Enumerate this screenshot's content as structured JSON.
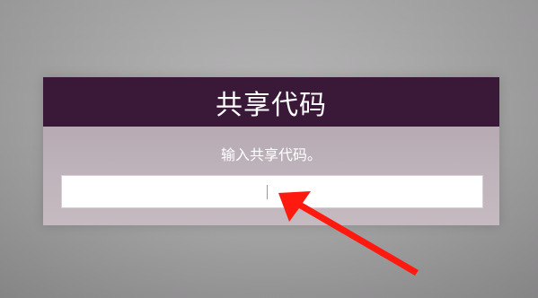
{
  "dialog": {
    "title": "共享代码",
    "prompt": "输入共享代码。",
    "input_value": ""
  },
  "colors": {
    "header_bg": "#3a1838",
    "annotation_arrow": "#ff1a0f"
  }
}
